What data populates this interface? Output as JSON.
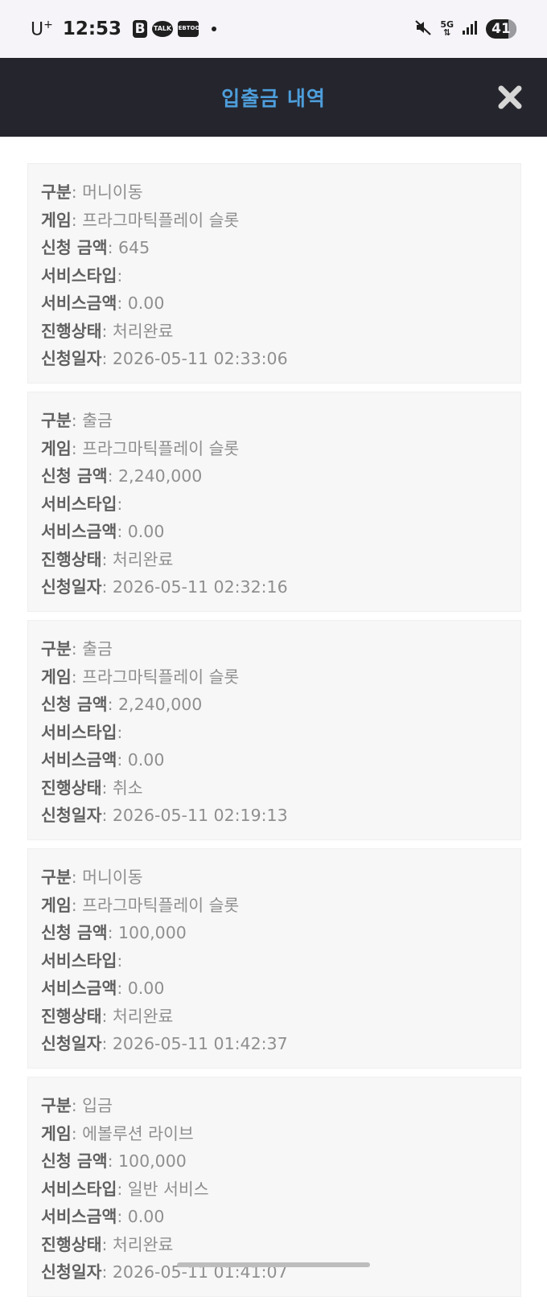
{
  "status_bar": {
    "carrier": "U",
    "carrier_sup": "+",
    "time": "12:53",
    "app_b": "B",
    "app_talk": "TALK",
    "app_webtoon_1": "WEB",
    "app_webtoon_2": "TOON",
    "network_5g_top": "5G",
    "network_5g_bottom": "⇅",
    "battery": "41"
  },
  "header": {
    "title": "입출금 내역"
  },
  "field_labels": {
    "type": "구분",
    "game": "게임",
    "amount": "신청 금액",
    "service_type": "서비스타입",
    "service_amount": "서비스금액",
    "status": "진행상태",
    "date": "신청일자"
  },
  "records": [
    {
      "type": "머니이동",
      "game": "프라그마틱플레이 슬롯",
      "amount": "645",
      "service_type": "",
      "service_amount": "0.00",
      "status": "처리완료",
      "date": "2026-05-11 02:33:06"
    },
    {
      "type": "출금",
      "game": "프라그마틱플레이 슬롯",
      "amount": "2,240,000",
      "service_type": "",
      "service_amount": "0.00",
      "status": "처리완료",
      "date": "2026-05-11 02:32:16"
    },
    {
      "type": "출금",
      "game": "프라그마틱플레이 슬롯",
      "amount": "2,240,000",
      "service_type": "",
      "service_amount": "0.00",
      "status": "취소",
      "date": "2026-05-11 02:19:13"
    },
    {
      "type": "머니이동",
      "game": "프라그마틱플레이 슬롯",
      "amount": "100,000",
      "service_type": "",
      "service_amount": "0.00",
      "status": "처리완료",
      "date": "2026-05-11 01:42:37"
    },
    {
      "type": "입금",
      "game": "에볼루션 라이브",
      "amount": "100,000",
      "service_type": "일반 서비스",
      "service_amount": "0.00",
      "status": "처리완료",
      "date": "2026-05-11 01:41:07"
    }
  ],
  "colors": {
    "header_bg": "#25252d",
    "header_title": "#4d9edb",
    "card_bg": "#f7f7f7",
    "label_text": "#606060",
    "value_text": "#8f8f8f"
  }
}
